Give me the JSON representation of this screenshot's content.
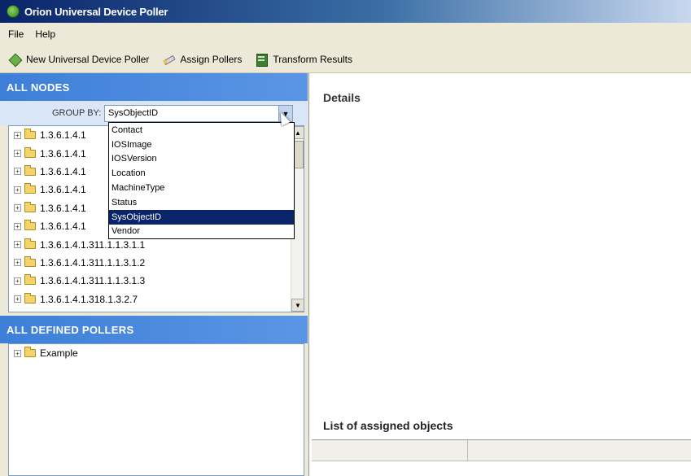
{
  "window": {
    "title": "Orion Universal Device Poller"
  },
  "menu": [
    {
      "label": "File"
    },
    {
      "label": "Help"
    }
  ],
  "toolbar": {
    "new_poller": "New Universal Device Poller",
    "assign": "Assign Pollers",
    "transform": "Transform Results"
  },
  "left": {
    "nodes_header": "ALL NODES",
    "groupby_label": "GROUP BY:",
    "groupby_value": "SysObjectID",
    "tree_items": [
      "1.3.6.1.4.1",
      "1.3.6.1.4.1",
      "1.3.6.1.4.1",
      "1.3.6.1.4.1",
      "1.3.6.1.4.1",
      "1.3.6.1.4.1",
      "1.3.6.1.4.1.311.1.1.3.1.1",
      "1.3.6.1.4.1.311.1.1.3.1.2",
      "1.3.6.1.4.1.311.1.1.3.1.3",
      "1.3.6.1.4.1.318.1.3.2.7"
    ],
    "dropdown_options": [
      "Contact",
      "IOSImage",
      "IOSVersion",
      "Location",
      "MachineType",
      "Status",
      "SysObjectID",
      "Vendor"
    ],
    "dropdown_selected": "SysObjectID",
    "pollers_header": "ALL DEFINED POLLERS",
    "pollers": [
      "Example"
    ]
  },
  "right": {
    "details_title": "Details",
    "assigned_title": "List of assigned objects"
  }
}
